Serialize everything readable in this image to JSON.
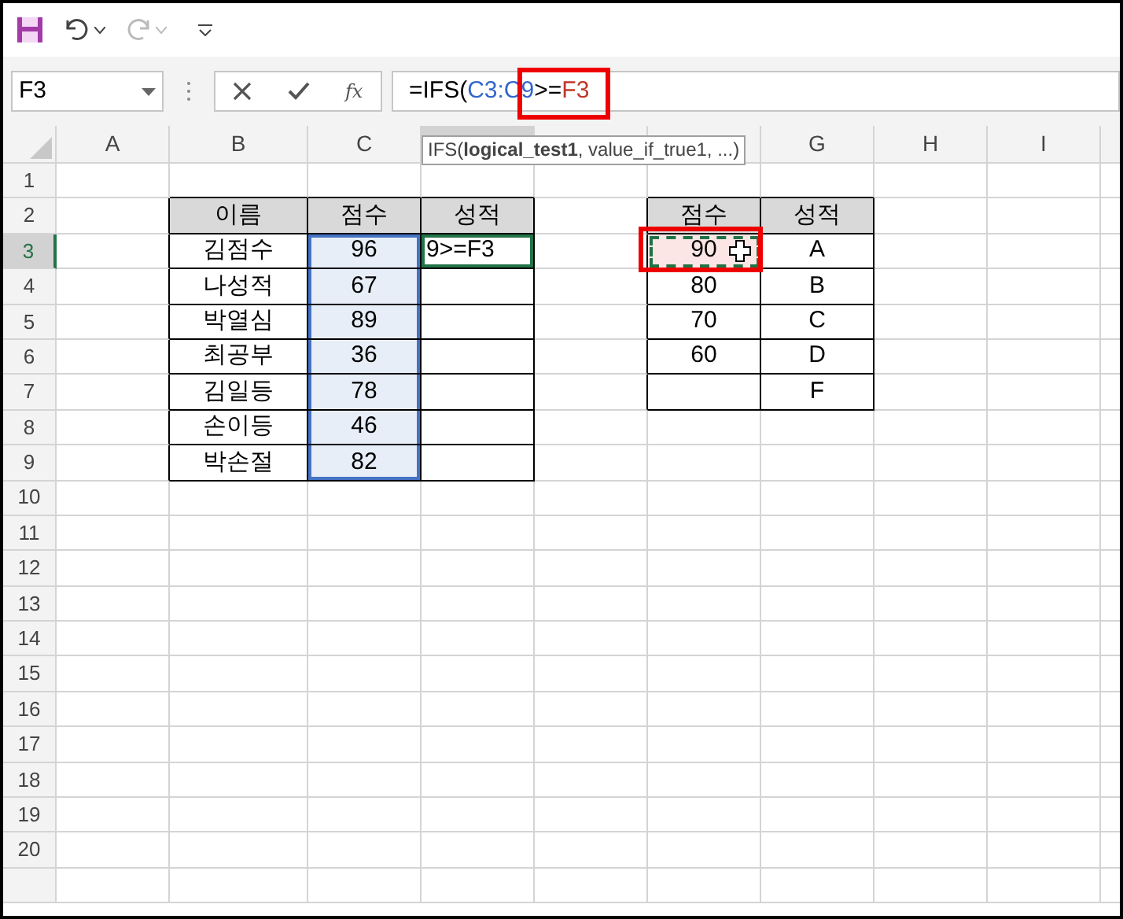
{
  "toolbar": {
    "redo_disabled": true
  },
  "name_box": {
    "value": "F3"
  },
  "formula_bar": {
    "function_label": "fx",
    "parts": [
      {
        "kind": "plain",
        "text": "=IFS("
      },
      {
        "kind": "range",
        "text": "C3:C9"
      },
      {
        "kind": "plain",
        "text": ">="
      },
      {
        "kind": "ref",
        "text": "F3"
      }
    ]
  },
  "tooltip": "IFS(**logical_test1**, value_if_true1, ...)",
  "columns": [
    {
      "label": "A",
      "selected": false
    },
    {
      "label": "B",
      "selected": false
    },
    {
      "label": "C",
      "selected": false
    },
    {
      "selected": true
    },
    {
      "selected": false
    },
    {
      "selected": false
    },
    {
      "label": "G",
      "selected": false
    },
    {
      "label": "H",
      "selected": false
    },
    {
      "label": "I",
      "selected": false
    }
  ],
  "rows": [
    {
      "label": "1",
      "selected": false
    },
    {
      "label": "2",
      "selected": false
    },
    {
      "label": "3",
      "selected": true
    },
    {
      "label": "4",
      "selected": false
    },
    {
      "label": "5",
      "selected": false
    },
    {
      "label": "6",
      "selected": false
    },
    {
      "label": "7",
      "selected": false
    },
    {
      "label": "8",
      "selected": false
    },
    {
      "label": "9",
      "selected": false
    },
    {
      "label": "10",
      "selected": false
    },
    {
      "label": "11",
      "selected": false
    },
    {
      "label": "12",
      "selected": false
    },
    {
      "label": "13",
      "selected": false
    },
    {
      "label": "14",
      "selected": false
    },
    {
      "label": "15",
      "selected": false
    },
    {
      "label": "16",
      "selected": false
    },
    {
      "label": "17",
      "selected": false
    },
    {
      "label": "18",
      "selected": false
    },
    {
      "label": "19",
      "selected": false
    },
    {
      "label": "20",
      "selected": false
    }
  ],
  "score_table": {
    "headers": [
      "이름",
      "점수",
      "성적"
    ],
    "rows": [
      {
        "name": "김점수",
        "score": "96",
        "grade": "9>=F3",
        "in_range": true,
        "editing": true
      },
      {
        "name": "나성적",
        "score": "67",
        "in_range": true,
        "editing": false
      },
      {
        "name": "박열심",
        "score": "89",
        "in_range": true,
        "editing": false
      },
      {
        "name": "최공부",
        "score": "36",
        "in_range": true,
        "editing": false
      },
      {
        "name": "김일등",
        "score": "78",
        "in_range": true,
        "editing": false
      },
      {
        "name": "손이등",
        "score": "46",
        "in_range": true,
        "editing": false
      },
      {
        "name": "박손절",
        "score": "82",
        "in_range": true,
        "editing": false
      }
    ]
  },
  "grade_table": {
    "headers": [
      "점수",
      "성적"
    ],
    "rows": [
      {
        "score": "90",
        "grade": "A",
        "marquee": true
      },
      {
        "score": "80",
        "grade": "B",
        "marquee": false
      },
      {
        "score": "70",
        "grade": "C",
        "marquee": false
      },
      {
        "score": "60",
        "grade": "D",
        "marquee": false
      },
      {
        "grade": "F",
        "marquee": false
      }
    ]
  }
}
